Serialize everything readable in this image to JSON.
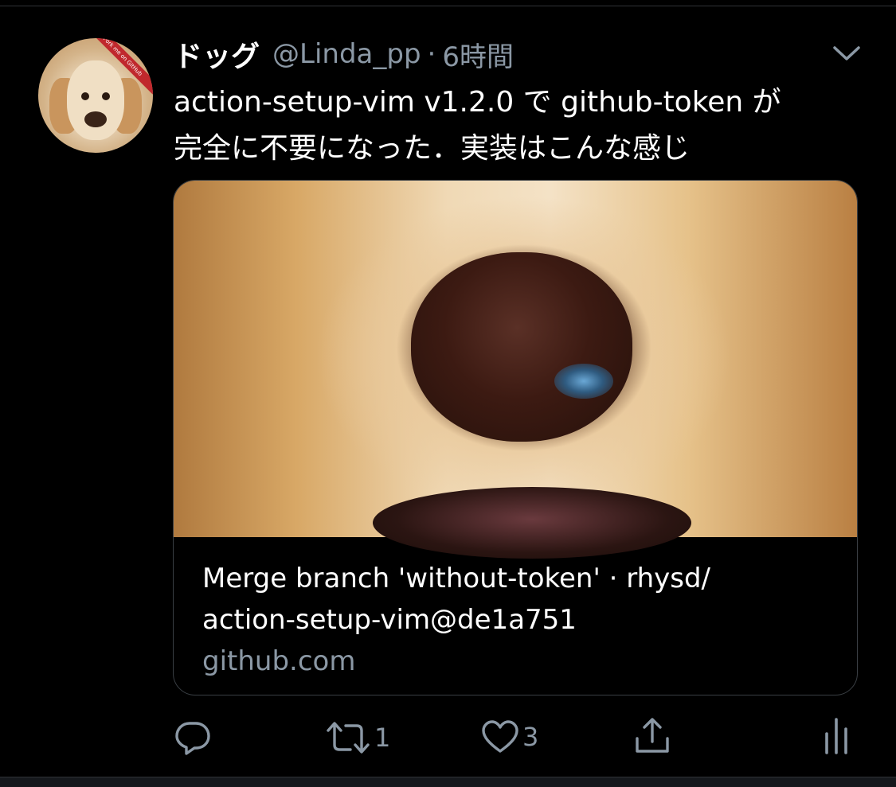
{
  "tweet": {
    "display_name": "ドッグ",
    "handle": "@Linda_pp",
    "separator": "·",
    "time": "6時間",
    "text_line1": "action-setup-vim v1.2.0 で github-token が",
    "text_line2": "完全に不要になった．実装はこんな感じ",
    "avatar_ribbon": "Fork me on GitHub"
  },
  "card": {
    "title_line1": "Merge branch 'without-token' · rhysd/",
    "title_line2": "action-setup-vim@de1a751",
    "domain": "github.com"
  },
  "actions": {
    "retweet_count": "1",
    "like_count": "3"
  },
  "icons": {
    "more": "chevron-down-icon",
    "reply": "reply-icon",
    "retweet": "retweet-icon",
    "like": "heart-icon",
    "share": "share-icon",
    "analytics": "analytics-icon"
  },
  "colors": {
    "background": "#000000",
    "text": "#ffffff",
    "muted": "#8b98a5",
    "border": "#3a3f44"
  }
}
